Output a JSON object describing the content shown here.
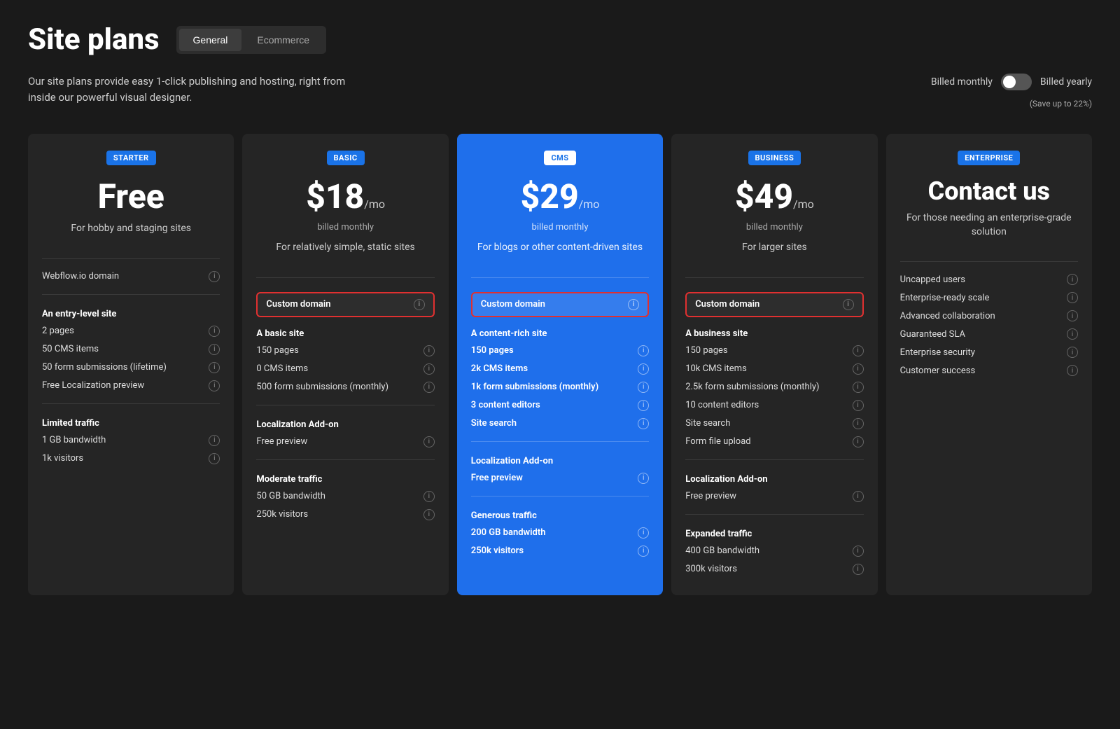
{
  "header": {
    "title": "Site plans",
    "tabs": [
      {
        "label": "General",
        "active": true
      },
      {
        "label": "Ecommerce",
        "active": false
      }
    ]
  },
  "subtitle": "Our site plans provide easy 1-click publishing and hosting, right from inside our powerful visual designer.",
  "billing": {
    "monthly_label": "Billed monthly",
    "yearly_label": "Billed yearly",
    "save_text": "(Save up to 22%)"
  },
  "plans": [
    {
      "id": "starter",
      "badge": "STARTER",
      "price": "Free",
      "is_free": true,
      "billed": "",
      "desc": "For hobby and staging sites",
      "highlight_row": "Webflow.io domain",
      "features_section1_label": "An entry-level site",
      "features_section1": [
        {
          "label": "2 pages"
        },
        {
          "label": "50 CMS items"
        },
        {
          "label": "50 form submissions (lifetime)"
        },
        {
          "label": "Free Localization preview"
        }
      ],
      "features_section2_label": "Limited traffic",
      "features_section2": [
        {
          "label": "1 GB bandwidth"
        },
        {
          "label": "1k visitors"
        }
      ]
    },
    {
      "id": "basic",
      "badge": "BASIC",
      "price": "$18",
      "unit": "/mo",
      "billed": "billed monthly",
      "desc": "For relatively simple, static sites",
      "highlight_row": "Custom domain",
      "features_section1_label": "A basic site",
      "features_section1": [
        {
          "label": "150 pages"
        },
        {
          "label": "0 CMS items"
        },
        {
          "label": "500 form submissions (monthly)"
        }
      ],
      "features_section2_label": "Localization Add-on",
      "features_section2": [
        {
          "label": "Free preview"
        }
      ],
      "features_section3_label": "Moderate traffic",
      "features_section3": [
        {
          "label": "50 GB bandwidth"
        },
        {
          "label": "250k visitors"
        }
      ]
    },
    {
      "id": "cms",
      "badge": "CMS",
      "price": "$29",
      "unit": "/mo",
      "billed": "billed monthly",
      "desc": "For blogs or other content-driven sites",
      "highlight_row": "Custom domain",
      "features_section1_label": "A content-rich site",
      "features_section1": [
        {
          "label": "150 pages"
        },
        {
          "label": "2k CMS items"
        },
        {
          "label": "1k form submissions (monthly)"
        },
        {
          "label": "3 content editors"
        },
        {
          "label": "Site search"
        }
      ],
      "features_section2_label": "Localization Add-on",
      "features_section2": [
        {
          "label": "Free preview"
        }
      ],
      "features_section3_label": "Generous traffic",
      "features_section3": [
        {
          "label": "200 GB bandwidth"
        },
        {
          "label": "250k visitors"
        }
      ]
    },
    {
      "id": "business",
      "badge": "BUSINESS",
      "price": "$49",
      "unit": "/mo",
      "billed": "billed monthly",
      "desc": "For larger sites",
      "highlight_row": "Custom domain",
      "features_section1_label": "A business site",
      "features_section1": [
        {
          "label": "150 pages"
        },
        {
          "label": "10k CMS items"
        },
        {
          "label": "2.5k form submissions (monthly)"
        },
        {
          "label": "10 content editors"
        },
        {
          "label": "Site search"
        },
        {
          "label": "Form file upload"
        }
      ],
      "features_section2_label": "Localization Add-on",
      "features_section2": [
        {
          "label": "Free preview"
        }
      ],
      "features_section3_label": "Expanded traffic",
      "features_section3": [
        {
          "label": "400 GB bandwidth"
        },
        {
          "label": "300k visitors"
        }
      ]
    },
    {
      "id": "enterprise",
      "badge": "ENTERPRISE",
      "price": "Contact us",
      "is_contact": true,
      "billed": "",
      "desc": "For those needing an enterprise-grade solution",
      "features_section1_label": "",
      "features_section1": [
        {
          "label": "Uncapped users"
        },
        {
          "label": "Enterprise-ready scale"
        },
        {
          "label": "Advanced collaboration"
        },
        {
          "label": "Guaranteed SLA"
        },
        {
          "label": "Enterprise security"
        },
        {
          "label": "Customer success"
        }
      ]
    }
  ]
}
